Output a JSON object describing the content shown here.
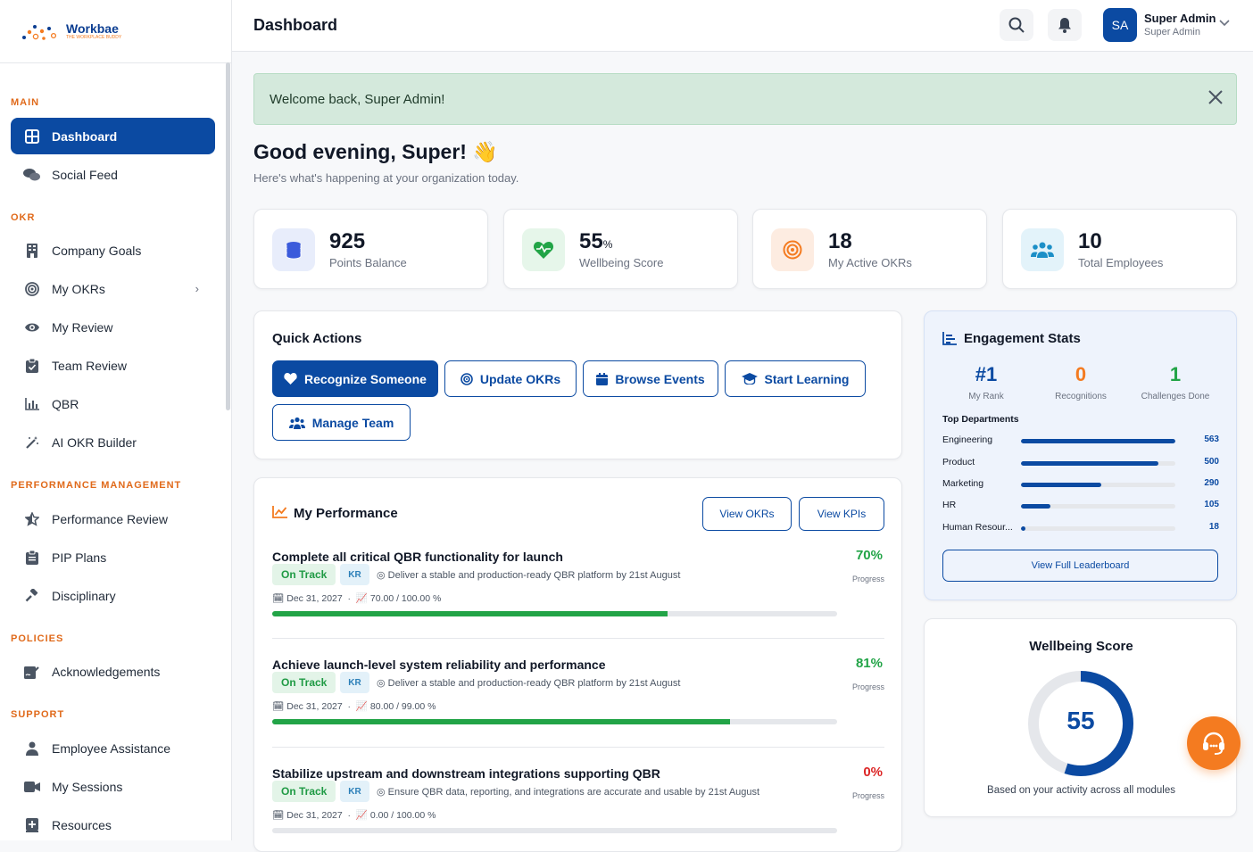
{
  "brand": {
    "name": "Workbae",
    "tagline": "THE WORKPLACE BUDDY"
  },
  "sidebar": {
    "sections": [
      {
        "label": "MAIN"
      },
      {
        "label": "OKR"
      },
      {
        "label": "PERFORMANCE MANAGEMENT"
      },
      {
        "label": "POLICIES"
      },
      {
        "label": "SUPPORT"
      }
    ],
    "items": [
      {
        "label": "Dashboard",
        "icon": "grid-icon",
        "active": true
      },
      {
        "label": "Social Feed",
        "icon": "chat-icon"
      },
      {
        "label": "Company Goals",
        "icon": "building-icon"
      },
      {
        "label": "My OKRs",
        "icon": "target-icon"
      },
      {
        "label": "My Review",
        "icon": "eye-icon"
      },
      {
        "label": "Team Review",
        "icon": "clipboard-check-icon"
      },
      {
        "label": "QBR",
        "icon": "bar-chart-icon"
      },
      {
        "label": "AI OKR Builder",
        "icon": "magic-wand-icon"
      },
      {
        "label": "Performance Review",
        "icon": "star-icon"
      },
      {
        "label": "PIP Plans",
        "icon": "clipboard-icon"
      },
      {
        "label": "Disciplinary",
        "icon": "gavel-icon"
      },
      {
        "label": "Acknowledgements",
        "icon": "signature-icon"
      },
      {
        "label": "Employee Assistance",
        "icon": "user-icon"
      },
      {
        "label": "My Sessions",
        "icon": "video-icon"
      },
      {
        "label": "Resources",
        "icon": "plus-box-icon"
      }
    ]
  },
  "header": {
    "title": "Dashboard",
    "user_initials": "SA",
    "user_name": "Super Admin",
    "user_role": "Super Admin"
  },
  "banner": {
    "text": "Welcome back, Super Admin!"
  },
  "greeting": {
    "title": "Good evening, Super! 👋",
    "subtitle": "Here's what's happening at your organization today."
  },
  "stats": [
    {
      "value": "925",
      "unit": "",
      "label": "Points Balance",
      "color": "#3b5bdb"
    },
    {
      "value": "55",
      "unit": "%",
      "label": "Wellbeing Score",
      "color": "#22a447"
    },
    {
      "value": "18",
      "unit": "",
      "label": "My Active OKRs",
      "color": "#f47b20"
    },
    {
      "value": "10",
      "unit": "",
      "label": "Total Employees",
      "color": "#1c8fc7"
    }
  ],
  "quick_actions": {
    "title": "Quick Actions",
    "buttons": [
      "Recognize Someone",
      "Update OKRs",
      "Browse Events",
      "Start Learning",
      "Manage Team"
    ]
  },
  "performance": {
    "title": "My Performance",
    "view_okrs": "View OKRs",
    "view_kpis": "View KPIs",
    "progress_label": "Progress",
    "goals": [
      {
        "title": "Complete all critical QBR functionality for launch",
        "percent": "70%",
        "progress": 70,
        "status": "On Track",
        "tag": "KR",
        "desc": "Deliver a stable and production-ready QBR platform by 21st August",
        "date": "Dec 31, 2027",
        "metric": "70.00 / 100.00 %",
        "color": "#22a447"
      },
      {
        "title": "Achieve launch-level system reliability and performance",
        "percent": "81%",
        "progress": 81,
        "status": "On Track",
        "tag": "KR",
        "desc": "Deliver a stable and production-ready QBR platform by 21st August",
        "date": "Dec 31, 2027",
        "metric": "80.00 / 99.00 %",
        "color": "#22a447"
      },
      {
        "title": "Stabilize upstream and downstream integrations supporting QBR",
        "percent": "0%",
        "progress": 0,
        "status": "On Track",
        "tag": "KR",
        "desc": "Ensure QBR data, reporting, and integrations are accurate and usable by 21st August",
        "date": "Dec 31, 2027",
        "metric": "0.00 / 100.00 %",
        "color": "#dc2626"
      }
    ]
  },
  "engagement": {
    "title": "Engagement Stats",
    "rank": "#1",
    "rank_label": "My Rank",
    "recognitions": "0",
    "recognitions_label": "Recognitions",
    "challenges": "1",
    "challenges_label": "Challenges Done",
    "top_label": "Top Departments",
    "departments": [
      {
        "name": "Engineering",
        "value": "563",
        "fraction": 1.0
      },
      {
        "name": "Product",
        "value": "500",
        "fraction": 0.89
      },
      {
        "name": "Marketing",
        "value": "290",
        "fraction": 0.52
      },
      {
        "name": "HR",
        "value": "105",
        "fraction": 0.19
      },
      {
        "name": "Human Resour...",
        "value": "18",
        "fraction": 0.03
      }
    ],
    "leaderboard_button": "View Full Leaderboard"
  },
  "wellbeing": {
    "title": "Wellbeing Score",
    "score": "55",
    "fraction": 0.55,
    "note": "Based on your activity across all modules"
  }
}
